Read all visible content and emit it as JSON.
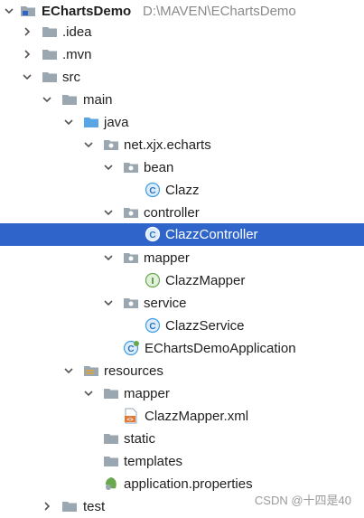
{
  "project": {
    "name": "EChartsDemo",
    "path": "D:\\MAVEN\\EChartsDemo"
  },
  "tree": {
    "idea": ".idea",
    "mvn": ".mvn",
    "src": "src",
    "main": "main",
    "java": "java",
    "package": "net.xjx.echarts",
    "bean": "bean",
    "clazz": "Clazz",
    "controller": "controller",
    "clazz_controller": "ClazzController",
    "mapper_pkg": "mapper",
    "clazz_mapper": "ClazzMapper",
    "service": "service",
    "clazz_service": "ClazzService",
    "app_class": "EChartsDemoApplication",
    "resources": "resources",
    "mapper_res": "mapper",
    "clazz_mapper_xml": "ClazzMapper.xml",
    "static": "static",
    "templates": "templates",
    "app_props": "application.properties",
    "test": "test"
  },
  "watermark": "CSDN @十四是40",
  "colors": {
    "selection": "#2f65ca",
    "folder": "#9aa7b0",
    "source_folder": "#5aa5e6",
    "class_icon": "#3d9ee6",
    "interface_icon": "#6aa84f"
  }
}
